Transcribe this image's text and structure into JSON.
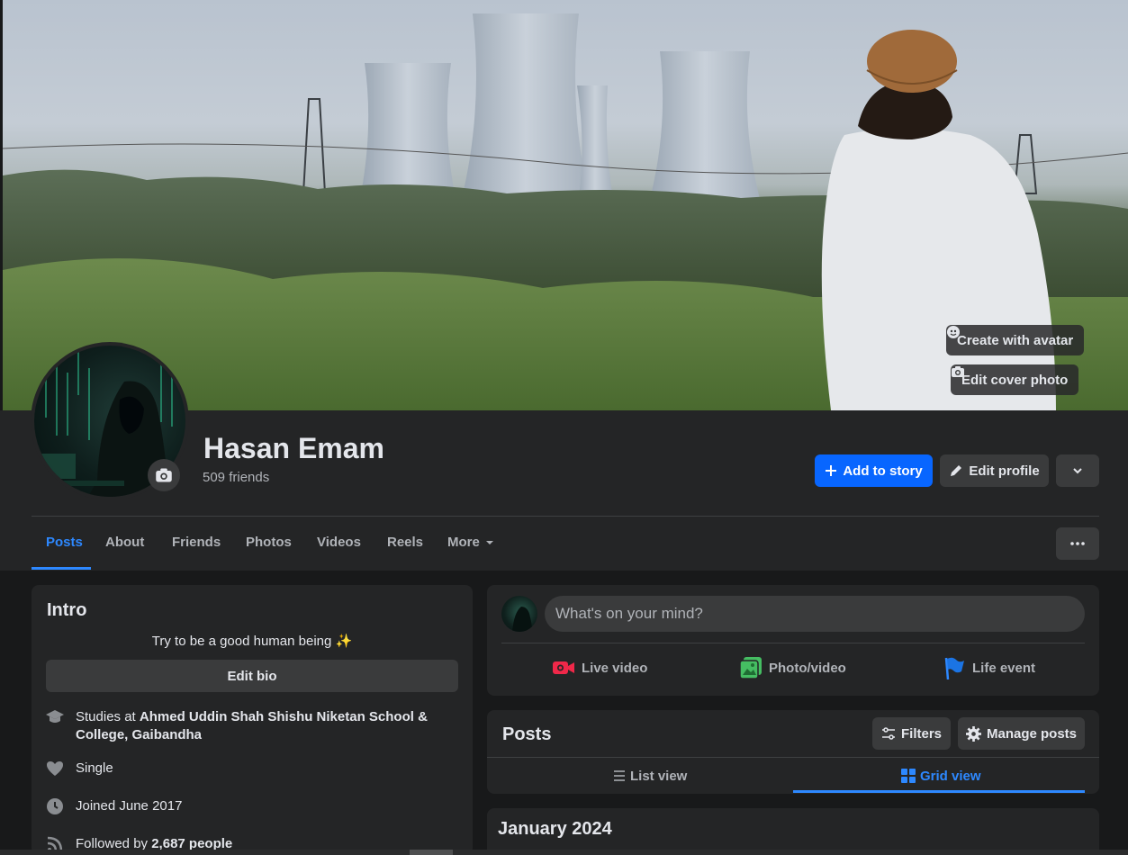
{
  "cover": {
    "create_avatar_label": "Create with avatar",
    "edit_cover_label": "Edit cover photo"
  },
  "profile": {
    "name": "Hasan Emam",
    "friends": "509 friends",
    "add_story_label": "Add to story",
    "edit_profile_label": "Edit profile"
  },
  "tabs": [
    {
      "label": "Posts",
      "active": true
    },
    {
      "label": "About"
    },
    {
      "label": "Friends"
    },
    {
      "label": "Photos"
    },
    {
      "label": "Videos"
    },
    {
      "label": "Reels"
    },
    {
      "label": "More"
    }
  ],
  "intro": {
    "title": "Intro",
    "bio": "Try to be a good human being ✨",
    "edit_bio_label": "Edit bio",
    "studies_prefix": "Studies at ",
    "studies_school": "Ahmed Uddin Shah Shishu Niketan School & College, Gaibandha",
    "relationship": "Single",
    "joined": "Joined June 2017",
    "followed_prefix": "Followed by ",
    "followed_count": "2,687 people"
  },
  "composer": {
    "placeholder": "What's on your mind?",
    "live_video": "Live video",
    "photo_video": "Photo/video",
    "life_event": "Life event"
  },
  "posts": {
    "title": "Posts",
    "filters_label": "Filters",
    "manage_label": "Manage posts",
    "list_view": "List view",
    "grid_view": "Grid view",
    "month": "January 2024"
  },
  "colors": {
    "accent": "#0866ff",
    "link_blue": "#2d88ff",
    "surface": "#242526",
    "background": "#18191a"
  }
}
